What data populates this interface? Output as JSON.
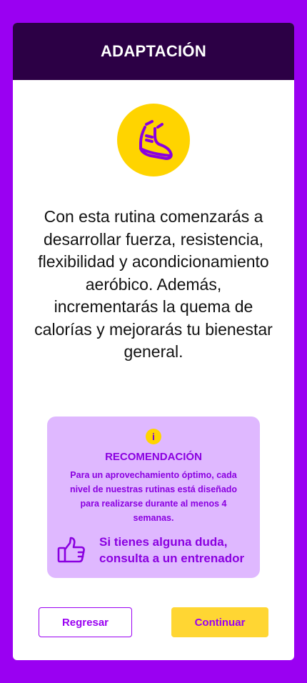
{
  "header": {
    "title": "ADAPTACIÓN"
  },
  "hero": {
    "icon": "running-shoe-icon"
  },
  "description": "Con esta rutina comenzarás a desarrollar fuerza, resistencia, flexibilidad y acondicionamiento aeróbico. Además, incrementarás la quema de calorías y mejorarás tu bienestar general.",
  "recommendation": {
    "info_icon": "i",
    "title": "RECOMENDACIÓN",
    "text": "Para un aprovechamiento óptimo, cada nivel de nuestras rutinas está diseñado para realizarse durante al menos 4 semanas.",
    "coach_icon": "thumbs-up-icon",
    "coach_text": "Si tienes alguna duda, consulta a un entrenador"
  },
  "buttons": {
    "back_label": "Regresar",
    "next_label": "Continuar"
  },
  "colors": {
    "background": "#9a00f2",
    "header": "#2c0045",
    "accent_yellow": "#ffd400",
    "recommendation_bg": "#dfb8ff",
    "accent_purple": "#8a00e0"
  }
}
